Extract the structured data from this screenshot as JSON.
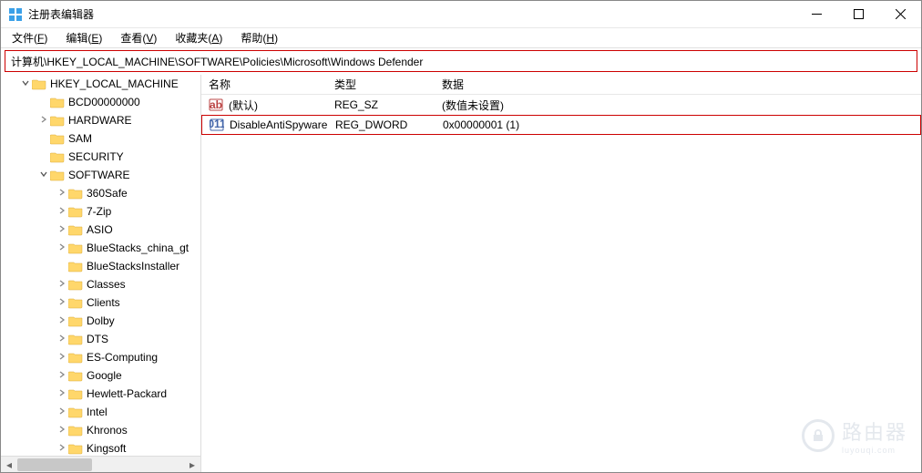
{
  "window": {
    "title": "注册表编辑器"
  },
  "menus": {
    "file": "文件(",
    "file_u": "F",
    "file2": ")",
    "edit": "编辑(",
    "edit_u": "E",
    "edit2": ")",
    "view": "查看(",
    "view_u": "V",
    "view2": ")",
    "fav": "收藏夹(",
    "fav_u": "A",
    "fav2": ")",
    "help": "帮助(",
    "help_u": "H",
    "help2": ")"
  },
  "address": "计算机\\HKEY_LOCAL_MACHINE\\SOFTWARE\\Policies\\Microsoft\\Windows Defender",
  "tree": [
    {
      "indent": 20,
      "ex": "v",
      "label": "HKEY_LOCAL_MACHINE"
    },
    {
      "indent": 40,
      "ex": "",
      "label": "BCD00000000"
    },
    {
      "indent": 40,
      "ex": ">",
      "label": "HARDWARE"
    },
    {
      "indent": 40,
      "ex": "",
      "label": "SAM"
    },
    {
      "indent": 40,
      "ex": "",
      "label": "SECURITY"
    },
    {
      "indent": 40,
      "ex": "v",
      "label": "SOFTWARE"
    },
    {
      "indent": 60,
      "ex": ">",
      "label": "360Safe"
    },
    {
      "indent": 60,
      "ex": ">",
      "label": "7-Zip"
    },
    {
      "indent": 60,
      "ex": ">",
      "label": "ASIO"
    },
    {
      "indent": 60,
      "ex": ">",
      "label": "BlueStacks_china_gt"
    },
    {
      "indent": 60,
      "ex": "",
      "label": "BlueStacksInstaller"
    },
    {
      "indent": 60,
      "ex": ">",
      "label": "Classes"
    },
    {
      "indent": 60,
      "ex": ">",
      "label": "Clients"
    },
    {
      "indent": 60,
      "ex": ">",
      "label": "Dolby"
    },
    {
      "indent": 60,
      "ex": ">",
      "label": "DTS"
    },
    {
      "indent": 60,
      "ex": ">",
      "label": "ES-Computing"
    },
    {
      "indent": 60,
      "ex": ">",
      "label": "Google"
    },
    {
      "indent": 60,
      "ex": ">",
      "label": "Hewlett-Packard"
    },
    {
      "indent": 60,
      "ex": ">",
      "label": "Intel"
    },
    {
      "indent": 60,
      "ex": ">",
      "label": "Khronos"
    },
    {
      "indent": 60,
      "ex": ">",
      "label": "Kingsoft"
    }
  ],
  "list": {
    "columns": {
      "name": "名称",
      "type": "类型",
      "data": "数据"
    },
    "rows": [
      {
        "icon": "string",
        "name": "(默认)",
        "type": "REG_SZ",
        "data": "(数值未设置)",
        "highlight": false
      },
      {
        "icon": "dword",
        "name": "DisableAntiSpyware",
        "type": "REG_DWORD",
        "data": "0x00000001 (1)",
        "highlight": true
      }
    ]
  },
  "watermark": {
    "text": "路由器",
    "sub": "luyouqi.com"
  }
}
